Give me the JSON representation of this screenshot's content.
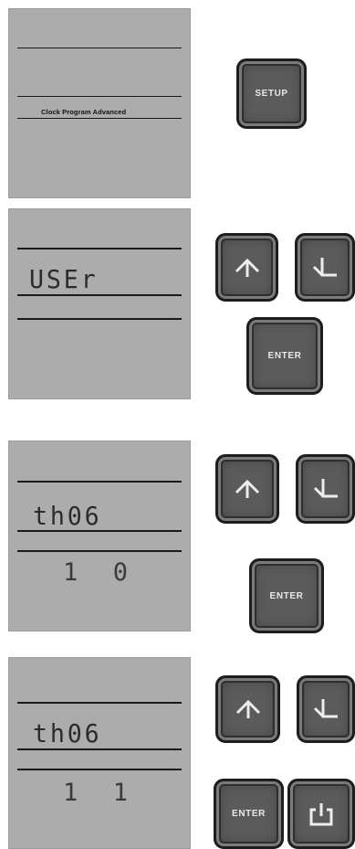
{
  "panel_1": {
    "display_caption": "Clock Program Advanced",
    "setup_key_label": "SETUP"
  },
  "panel_2": {
    "display_main": "USEr",
    "enter_key_label": "ENTER"
  },
  "panel_3": {
    "display_main": "th06",
    "display_sub": "1  0",
    "enter_key_label": "ENTER"
  },
  "panel_4": {
    "display_main": "th06",
    "display_sub": "1  1",
    "enter_key_label": "ENTER"
  },
  "icons": {
    "up": "arrow-up-icon",
    "down": "arrow-down-icon",
    "power": "power-icon"
  },
  "colors": {
    "lcd_background": "#acacac",
    "key_face": "#5b5b5b",
    "key_label": "#e8e8e8"
  }
}
